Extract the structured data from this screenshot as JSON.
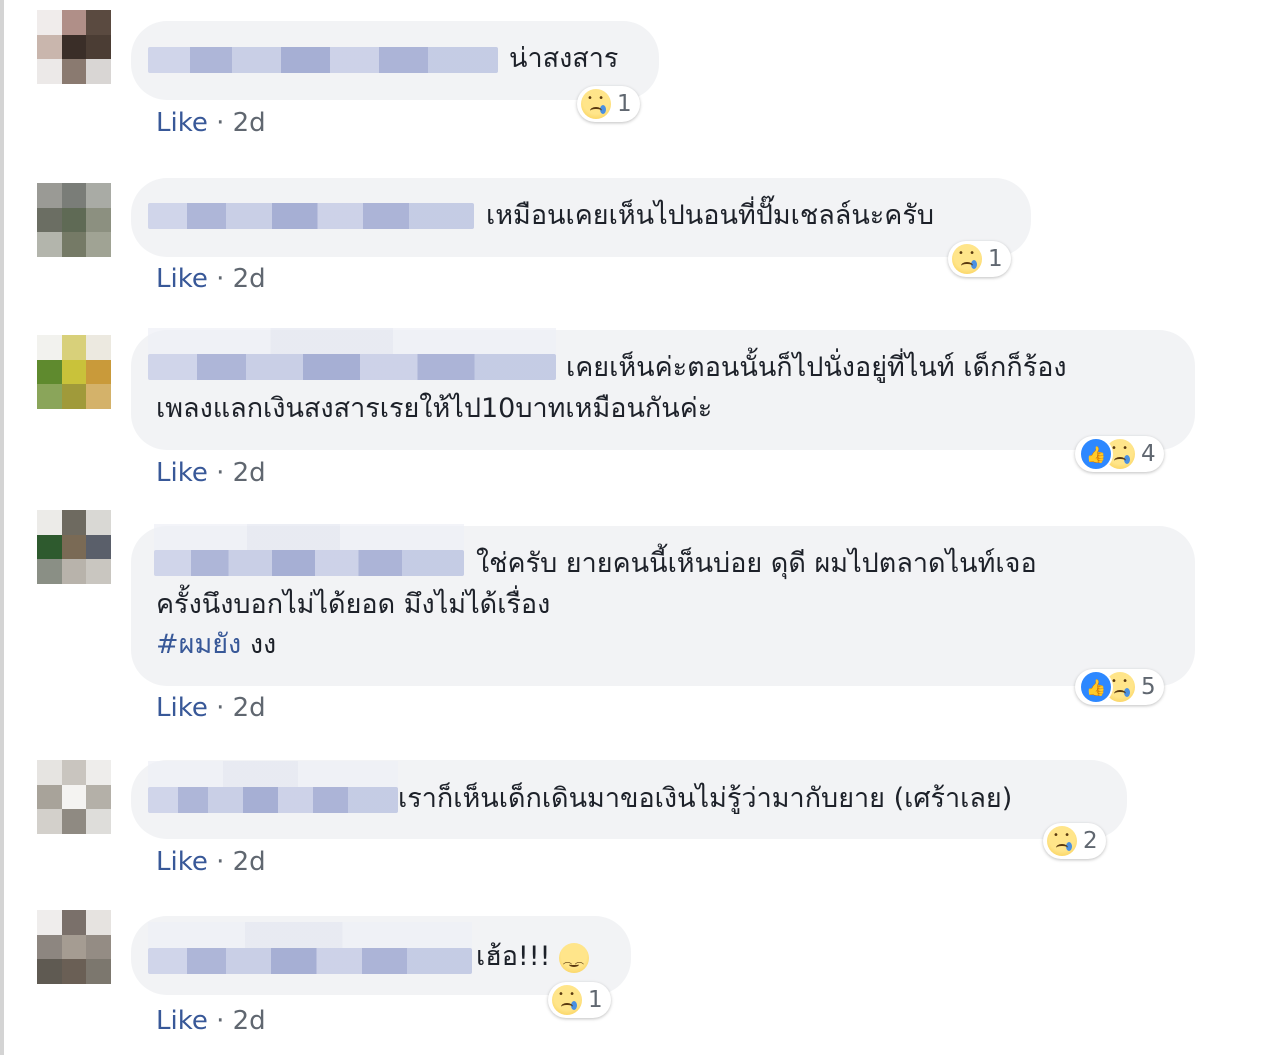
{
  "comments": [
    {
      "text_lines": [
        "น่าสงสาร"
      ],
      "reactions": {
        "count": "1",
        "types": [
          "sad"
        ]
      },
      "like_label": "Like",
      "time": "2d"
    },
    {
      "text_lines": [
        "เหมือนเคยเห็นไปนอนที่ปั๊มเชลล์นะครับ"
      ],
      "reactions": {
        "count": "1",
        "types": [
          "sad"
        ]
      },
      "like_label": "Like",
      "time": "2d"
    },
    {
      "text_lines": [
        "เคยเห็นค่ะตอนนั้นก็ไปนั่งอยู่ที่ไนท์ เด็กก็ร้อง",
        "เพลงแลกเงินสงสารเรยให้ไป10บาทเหมือนกันค่ะ"
      ],
      "reactions": {
        "count": "4",
        "types": [
          "like",
          "sad"
        ]
      },
      "like_label": "Like",
      "time": "2d"
    },
    {
      "text_lines": [
        "ใช่ครับ ยายคนนี้เห็นบ่อย ดุดี ผมไปตลาดไนท์เจอ",
        "ครั้งนึงบอกไม่ได้ยอด มึงไม่ได้เรื่อง"
      ],
      "hashtag": "#ผมยัง",
      "hashtag_rest": " งง",
      "reactions": {
        "count": "5",
        "types": [
          "like",
          "sad"
        ]
      },
      "like_label": "Like",
      "time": "2d"
    },
    {
      "text_lines": [
        "เราก็เห็นเด็กเดินมาขอเงินไม่รู้ว่ามากับยาย (เศร้าเลย)"
      ],
      "reactions": {
        "count": "2",
        "types": [
          "sad"
        ]
      },
      "like_label": "Like",
      "time": "2d"
    },
    {
      "text_lines": [
        "เฮ้อ!!!"
      ],
      "inline_emoji": "relieved-face-icon",
      "reactions": {
        "count": "1",
        "types": [
          "sad"
        ]
      },
      "like_label": "Like",
      "time": "2d"
    }
  ],
  "colors": {
    "bubble": "#f2f3f5",
    "link": "#385898",
    "text": "#1d2129",
    "meta": "#606770",
    "like_reaction": "#2d88ff"
  },
  "separator": " · "
}
